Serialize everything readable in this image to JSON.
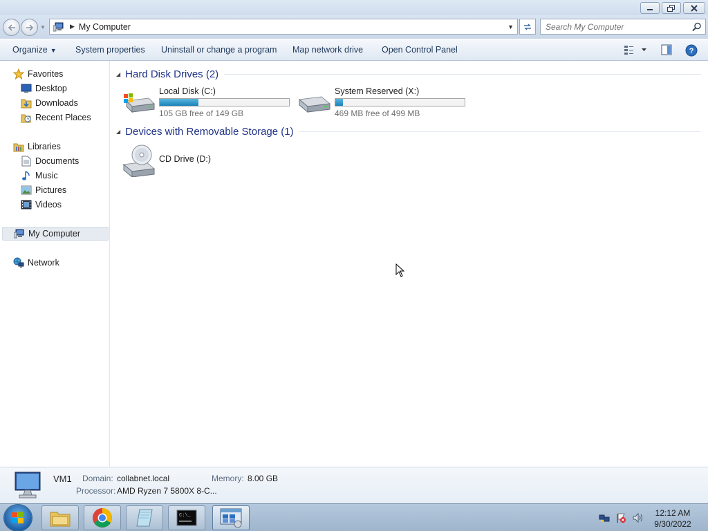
{
  "window": {
    "controls": {
      "minimize": "minimize-icon",
      "restore": "restore-icon",
      "close": "close-icon"
    }
  },
  "address": {
    "location": "My Computer",
    "search_placeholder": "Search My Computer"
  },
  "toolbar": {
    "organize": "Organize",
    "system_properties": "System properties",
    "uninstall": "Uninstall or change a program",
    "map_drive": "Map network drive",
    "control_panel": "Open Control Panel"
  },
  "nav": {
    "favorites": "Favorites",
    "desktop": "Desktop",
    "downloads": "Downloads",
    "recent_places": "Recent Places",
    "libraries": "Libraries",
    "documents": "Documents",
    "music": "Music",
    "pictures": "Pictures",
    "videos": "Videos",
    "my_computer": "My Computer",
    "network": "Network"
  },
  "groups": {
    "hdd": {
      "title": "Hard Disk Drives (2)",
      "drives": [
        {
          "name": "Local Disk (C:)",
          "free": "105 GB free of 149 GB",
          "used_fraction": 0.3
        },
        {
          "name": "System Reserved (X:)",
          "free": "469 MB free of 499 MB",
          "used_fraction": 0.06
        }
      ]
    },
    "removable": {
      "title": "Devices with Removable Storage (1)",
      "drives": [
        {
          "name": "CD Drive (D:)"
        }
      ]
    }
  },
  "details": {
    "name": "VM1",
    "domain_label": "Domain:",
    "domain": "collabnet.local",
    "memory_label": "Memory:",
    "memory": "8.00 GB",
    "processor_label": "Processor:",
    "processor": "AMD Ryzen 7 5800X 8-C..."
  },
  "taskbar": {
    "time": "12:12 AM",
    "date": "9/30/2022"
  },
  "colors": {
    "group_title": "#1e3287",
    "bar_fill": "#1b82b8",
    "toolbar_text": "#1e395b"
  }
}
